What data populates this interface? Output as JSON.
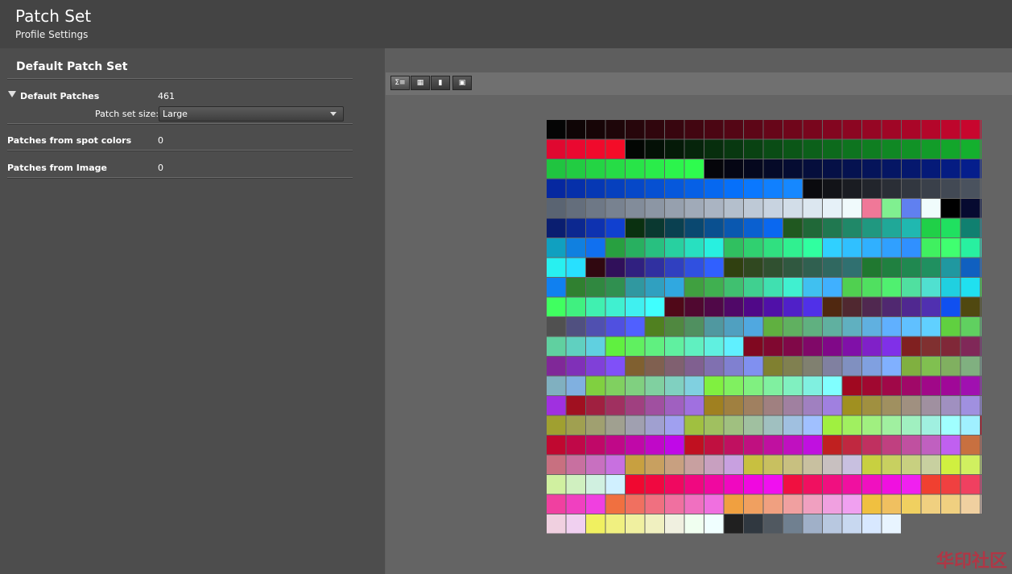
{
  "header": {
    "title": "Patch Set",
    "subtitle": "Profile Settings"
  },
  "left": {
    "section_title": "Default Patch Set",
    "default_patches": {
      "label": "Default Patches",
      "value": "461"
    },
    "patch_set_size": {
      "label": "Patch set size:",
      "value": "Large"
    },
    "spot": {
      "label": "Patches from spot colors",
      "value": "0"
    },
    "image": {
      "label": "Patches from Image",
      "value": "0"
    }
  },
  "toolbar": {
    "buttons": [
      {
        "name": "sum-list-view-icon",
        "glyph": "Σ≡",
        "active": true
      },
      {
        "name": "grid-view-icon",
        "glyph": "▦",
        "active": false
      },
      {
        "name": "spot-color-icon",
        "glyph": "▮",
        "active": false
      },
      {
        "name": "image-icon",
        "glyph": "▣",
        "active": false
      }
    ]
  },
  "patch_colors": [
    "#050505",
    "#0f0506",
    "#170507",
    "#1e0609",
    "#27060b",
    "#30060d",
    "#38060f",
    "#420611",
    "#4b0613",
    "#540615",
    "#5d0617",
    "#670619",
    "#70061b",
    "#79061d",
    "#830620",
    "#8c0622",
    "#960624",
    "#a00626",
    "#aa0628",
    "#b4062a",
    "#be062c",
    "#c8062e",
    "#d20630",
    "#e00830",
    "#ea0830",
    "#f00a2c",
    "#f40c28",
    "#030603",
    "#041006",
    "#051a08",
    "#06240b",
    "#072e0d",
    "#083810",
    "#094212",
    "#0a4c15",
    "#0b5617",
    "#0c601a",
    "#0d6a1c",
    "#0e741f",
    "#0f7e21",
    "#108824",
    "#119226",
    "#129c29",
    "#13a62b",
    "#14b02e",
    "#15ba30",
    "#20c440",
    "#22cc42",
    "#24d444",
    "#26dc46",
    "#28e448",
    "#2aec4a",
    "#2cf44c",
    "#2efc4e",
    "#05050a",
    "#050614",
    "#05081e",
    "#050a28",
    "#050c32",
    "#050e3c",
    "#051046",
    "#051250",
    "#05145a",
    "#051664",
    "#05186e",
    "#051a78",
    "#051c82",
    "#051e8c",
    "#052096",
    "#0628a0",
    "#0630aa",
    "#0638b4",
    "#0640be",
    "#0648c8",
    "#0650d2",
    "#0658dc",
    "#0660e6",
    "#0668f0",
    "#0670fa",
    "#0a78ff",
    "#1080ff",
    "#1688ff",
    "#0a0a0e",
    "#121318",
    "#1a1c22",
    "#22252c",
    "#2a2e36",
    "#323740",
    "#3a404a",
    "#424954",
    "#4a525e",
    "#525b68",
    "#5a6472",
    "#646e7c",
    "#6e7886",
    "#788290",
    "#828c9a",
    "#8c96a4",
    "#96a0ae",
    "#a0aab8",
    "#aab4c2",
    "#b4bfcc",
    "#bec9d6",
    "#c8d3e0",
    "#d2dde8",
    "#dce7f0",
    "#e6f1f8",
    "#f0fafc",
    "#f07898",
    "#80f090",
    "#6080f0",
    "#f0fcfc",
    "#000000",
    "#060a30",
    "#081450",
    "#0a1e70",
    "#0c2890",
    "#0e32b0",
    "#1040d0",
    "#0a3010",
    "#0a3830",
    "#0a4050",
    "#0a4870",
    "#0a5090",
    "#0a58b0",
    "#0a60d0",
    "#0a68f0",
    "#205820",
    "#206838",
    "#207850",
    "#208868",
    "#209880",
    "#20a898",
    "#20b8b0",
    "#20d048",
    "#20e060",
    "#108070",
    "#1090a0",
    "#10a0c0",
    "#1080e0",
    "#1070f0",
    "#28a040",
    "#28b060",
    "#28c080",
    "#28d0a0",
    "#28e0c0",
    "#28f0e0",
    "#30c060",
    "#30d070",
    "#30e080",
    "#30f090",
    "#30ffa0",
    "#30d0ff",
    "#30c0ff",
    "#30b0ff",
    "#30a0ff",
    "#3090ff",
    "#40f060",
    "#40ff70",
    "#28f0a0",
    "#28f0d0",
    "#28f0f0",
    "#28e0ff",
    "#300810",
    "#30105a",
    "#302080",
    "#3030a0",
    "#3040c0",
    "#3050e0",
    "#3060ff",
    "#304010",
    "#304820",
    "#305030",
    "#305840",
    "#306050",
    "#306860",
    "#307070",
    "#207830",
    "#208040",
    "#208850",
    "#209060",
    "#2098a0",
    "#1060c0",
    "#1070e0",
    "#1080f0",
    "#308030",
    "#308840",
    "#309050",
    "#3098a0",
    "#30a0c0",
    "#30a8e0",
    "#40a040",
    "#40b050",
    "#40c070",
    "#40d090",
    "#40e0b0",
    "#40f0d0",
    "#40c0f0",
    "#40b0ff",
    "#50d050",
    "#50e060",
    "#50f070",
    "#50e0a0",
    "#50e0d0",
    "#20d0e0",
    "#20e0f0",
    "#40f050",
    "#40ff60",
    "#40f080",
    "#40f0b0",
    "#40f0d0",
    "#40f0f0",
    "#40ffff",
    "#500818",
    "#500830",
    "#500848",
    "#500868",
    "#500888",
    "#5010a8",
    "#5020c8",
    "#5030e8",
    "#502810",
    "#502830",
    "#502850",
    "#502870",
    "#502890",
    "#5030b0",
    "#1050f0",
    "#504810",
    "#505020",
    "#505050",
    "#505080",
    "#5050b0",
    "#5050e0",
    "#5060ff",
    "#508020",
    "#508840",
    "#509060",
    "#5098a0",
    "#50a0c0",
    "#50a8e0",
    "#60b040",
    "#60b060",
    "#60b080",
    "#60b0a0",
    "#60b0c0",
    "#60b0e0",
    "#60b0ff",
    "#60c0ff",
    "#60d0ff",
    "#60d040",
    "#60d060",
    "#60d080",
    "#60d0a0",
    "#60d0c0",
    "#60d0e0",
    "#60f040",
    "#60f060",
    "#60f080",
    "#60f0a0",
    "#60f0c0",
    "#60f0e0",
    "#60f0ff",
    "#800820",
    "#800830",
    "#800848",
    "#800868",
    "#800888",
    "#8010a8",
    "#8020c8",
    "#8030e8",
    "#802020",
    "#803030",
    "#802838",
    "#802858",
    "#802878",
    "#802898",
    "#8030b8",
    "#8040d8",
    "#8050f8",
    "#806030",
    "#806050",
    "#806070",
    "#806090",
    "#8070b0",
    "#8080d0",
    "#8090f0",
    "#808030",
    "#808050",
    "#808070",
    "#8080a0",
    "#8090c0",
    "#80a0e0",
    "#80b0ff",
    "#80b040",
    "#80c050",
    "#80b060",
    "#80b080",
    "#80b0a0",
    "#80b0c0",
    "#80b0e0",
    "#80d040",
    "#80d060",
    "#80d080",
    "#80d0a0",
    "#80d0c0",
    "#80d0e0",
    "#80f040",
    "#80f060",
    "#80f080",
    "#80f0a0",
    "#80f0c0",
    "#80f0e0",
    "#80ffff",
    "#a00820",
    "#a00830",
    "#a00848",
    "#a00868",
    "#a00888",
    "#a00898",
    "#a010b0",
    "#a020c8",
    "#a030e0",
    "#a01020",
    "#a02040",
    "#a03060",
    "#a04080",
    "#a050a0",
    "#a060c0",
    "#a070e0",
    "#a08020",
    "#a08040",
    "#a08060",
    "#a08080",
    "#a080a0",
    "#a080c0",
    "#a080e0",
    "#a09020",
    "#a09040",
    "#a09060",
    "#a09080",
    "#a090a0",
    "#a090c0",
    "#a090e0",
    "#a090ff",
    "#a0a030",
    "#a0a050",
    "#a0a070",
    "#a0a090",
    "#a0a0b0",
    "#a0a0d0",
    "#a0a0f0",
    "#a0c040",
    "#a0c060",
    "#a0c080",
    "#a0c0a0",
    "#a0c0c0",
    "#a0c0e0",
    "#a0c0ff",
    "#a0f040",
    "#a0f060",
    "#a0f080",
    "#a0f0a0",
    "#a0f0c0",
    "#a0f0e0",
    "#a0ffff",
    "#a0f0ff",
    "#c00820",
    "#c00830",
    "#c00848",
    "#c00868",
    "#c00888",
    "#c008a8",
    "#c008c8",
    "#c008e8",
    "#c01020",
    "#c01040",
    "#c01060",
    "#c01080",
    "#c010a0",
    "#c010c0",
    "#c010e0",
    "#c02020",
    "#c02840",
    "#c03060",
    "#c04080",
    "#c050a0",
    "#c060c0",
    "#c060f0",
    "#c87040",
    "#c87060",
    "#c87080",
    "#c870a0",
    "#c870c0",
    "#c870e0",
    "#c8a040",
    "#c8a060",
    "#c8a080",
    "#c8a0a0",
    "#c8a0c0",
    "#c8a0e0",
    "#c8c040",
    "#c8c060",
    "#c8c080",
    "#c8c0a0",
    "#c8c0c0",
    "#c8c0e0",
    "#c8d040",
    "#c8d060",
    "#c8d080",
    "#c8d0a0",
    "#d0f040",
    "#d0f060",
    "#d0f080",
    "#d0f0a0",
    "#d0f0c0",
    "#d0f0e0",
    "#d0f0ff",
    "#f00830",
    "#f00840",
    "#f00860",
    "#f00880",
    "#f008a0",
    "#f008c0",
    "#f008e0",
    "#f010f0",
    "#f01040",
    "#f01060",
    "#f01080",
    "#f010a0",
    "#f010c0",
    "#f010e0",
    "#f020f0",
    "#f04030",
    "#f04040",
    "#f04060",
    "#f04080",
    "#f040a0",
    "#f040c0",
    "#f040e0",
    "#f07040",
    "#f07060",
    "#f07080",
    "#f070a0",
    "#f070c0",
    "#f070e0",
    "#f0a040",
    "#f0a060",
    "#f0a080",
    "#f0a0a0",
    "#f0a0c0",
    "#f0a0e0",
    "#f0a0f0",
    "#f0c040",
    "#f0c060",
    "#f0d060",
    "#f0d080",
    "#f0d080",
    "#f0d0a0",
    "#f0d0c0",
    "#f0d0e0",
    "#f0d0f0",
    "#f0f060",
    "#f0f080",
    "#f0f0a0",
    "#f0f0c0",
    "#f0f0e0",
    "#f0fff0",
    "#f0ffff",
    "#202020",
    "#303840",
    "#505860",
    "#708090",
    "#a0b0c8",
    "#b8c8e0",
    "#c8d8f0",
    "#d8e8ff",
    "#e8f4ff"
  ]
}
